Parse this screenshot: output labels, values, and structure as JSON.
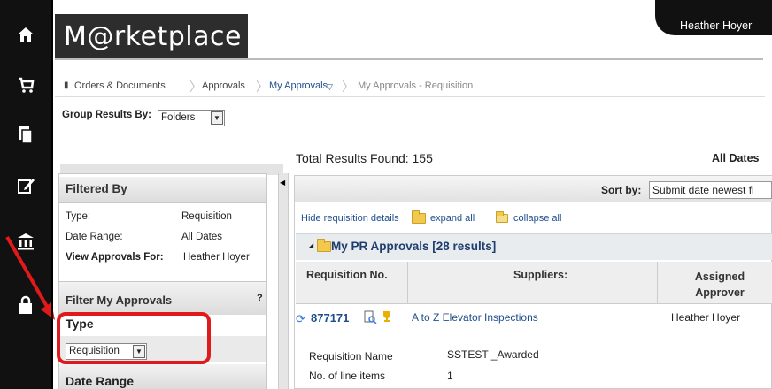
{
  "app": {
    "title": "M@rketplace",
    "user": "Heather Hoyer"
  },
  "rail": {
    "icons": [
      "home-icon",
      "cart-icon",
      "documents-icon",
      "edit-icon",
      "institution-icon",
      "lock-icon"
    ]
  },
  "breadcrumb": {
    "items": [
      "Orders & Documents",
      "Approvals",
      "My Approvals",
      "My Approvals - Requisition"
    ]
  },
  "group": {
    "label": "Group Results By:",
    "value": "Folders"
  },
  "results": {
    "total": "Total Results Found: 155",
    "dates": "All Dates"
  },
  "filtered": {
    "title": "Filtered By",
    "rows": [
      {
        "label": "Type:",
        "value": "Requisition"
      },
      {
        "label": "Date Range:",
        "value": "All Dates"
      },
      {
        "label": "View Approvals For:",
        "value": "Heather Hoyer"
      }
    ]
  },
  "filter_my": {
    "title": "Filter My Approvals",
    "help": "?",
    "type_label": "Type",
    "type_value": "Requisition",
    "date_label": "Date Range"
  },
  "sort": {
    "label": "Sort by:",
    "value": "Submit date newest fi"
  },
  "details": {
    "hide": "Hide requisition details",
    "expand": "expand all",
    "collapse": "collapse all"
  },
  "group_row": {
    "title": "My PR Approvals [28 results]"
  },
  "table": {
    "headers": [
      "Requisition No.",
      "Suppliers:",
      "Assigned Approver"
    ],
    "row": {
      "number": "877171",
      "supplier": "A to Z Elevator Inspections",
      "approver": "Heather Hoyer",
      "details": [
        {
          "label": "Requisition Name",
          "value": "SSTEST _Awarded"
        },
        {
          "label": "No. of line items",
          "value": "1"
        }
      ]
    }
  },
  "colors": {
    "accent_red": "#e01a1a",
    "link": "#1f4e8c",
    "rail": "#111111"
  }
}
